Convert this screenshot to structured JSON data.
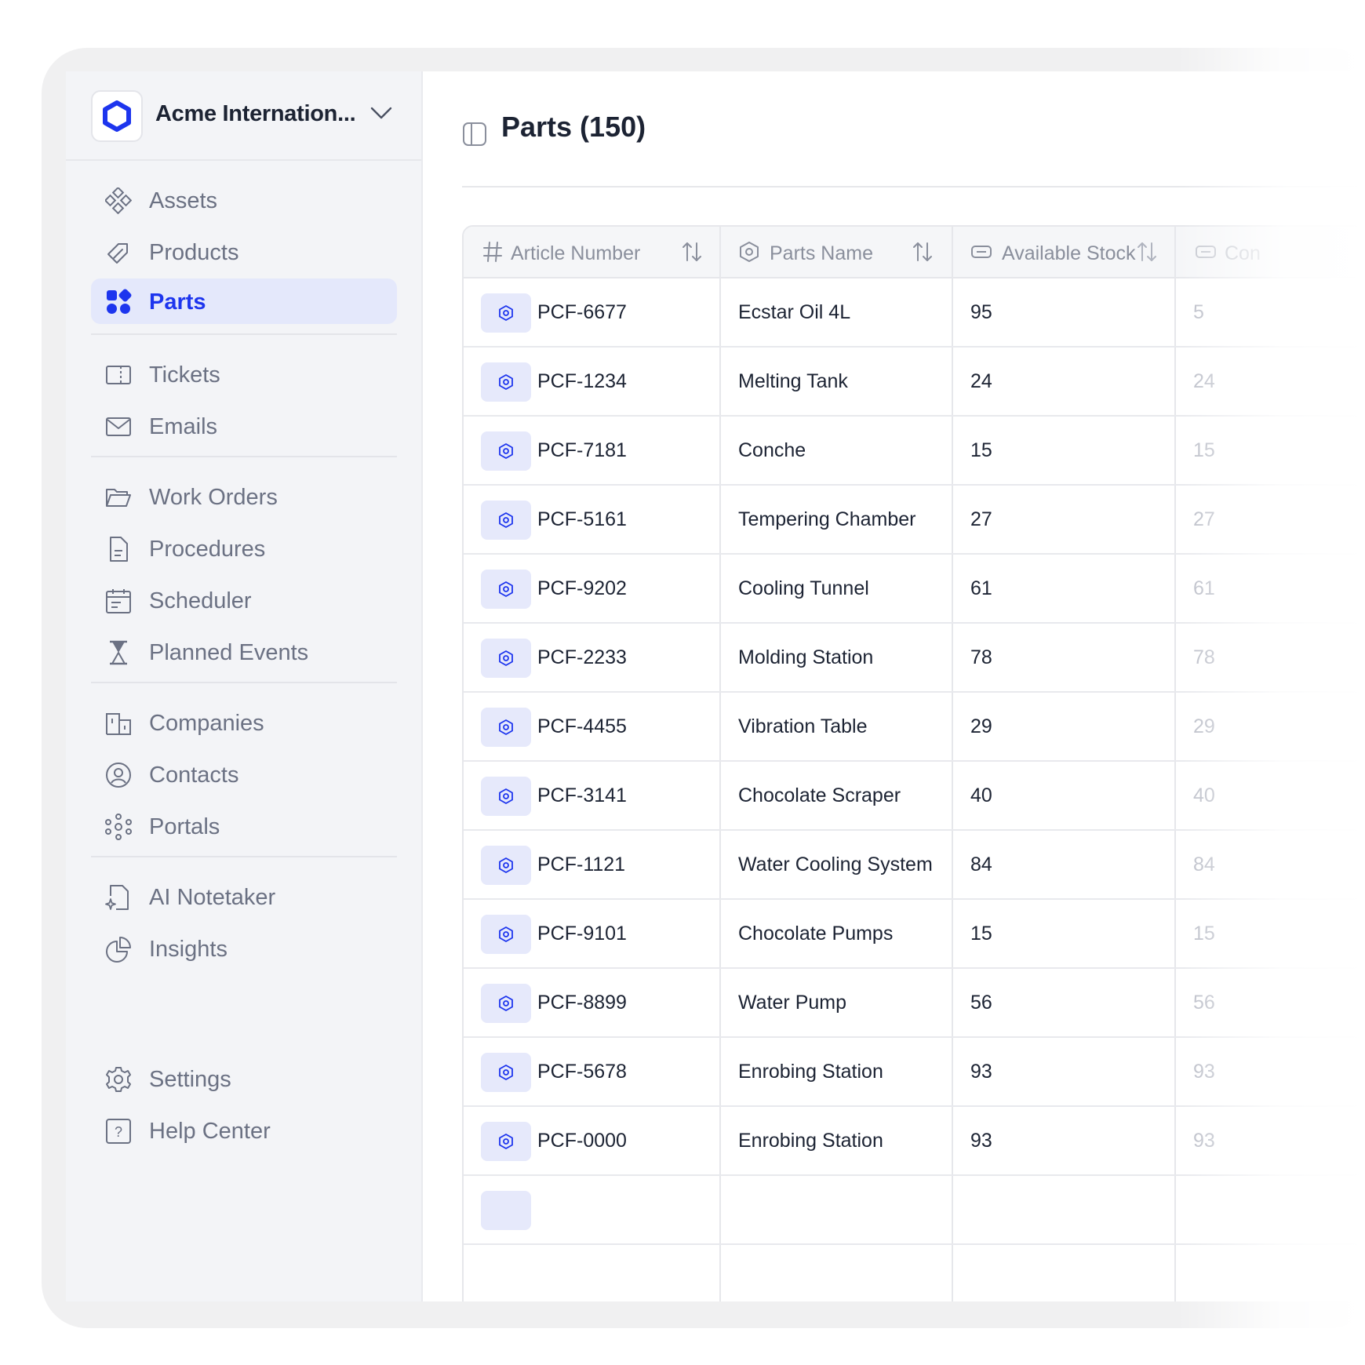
{
  "org": {
    "name": "Acme Internation..."
  },
  "nav": {
    "assets": "Assets",
    "products": "Products",
    "parts": "Parts",
    "tickets": "Tickets",
    "emails": "Emails",
    "work_orders": "Work Orders",
    "procedures": "Procedures",
    "scheduler": "Scheduler",
    "planned_events": "Planned Events",
    "companies": "Companies",
    "contacts": "Contacts",
    "portals": "Portals",
    "ai_notetaker": "AI Notetaker",
    "insights": "Insights",
    "settings": "Settings",
    "help_center": "Help Center"
  },
  "page": {
    "title": "Parts (150)"
  },
  "table": {
    "columns": [
      "Article Number",
      "Parts Name",
      "Available Stock",
      "Con"
    ],
    "rows": [
      [
        "PCF-6677",
        "Ecstar Oil 4L",
        "95",
        "5"
      ],
      [
        "PCF-1234",
        "Melting Tank",
        "24",
        "24"
      ],
      [
        "PCF-7181",
        "Conche",
        "15",
        "15"
      ],
      [
        "PCF-5161",
        "Tempering Chamber",
        "27",
        "27"
      ],
      [
        "PCF-9202",
        "Cooling Tunnel",
        "61",
        "61"
      ],
      [
        "PCF-2233",
        "Molding Station",
        "78",
        "78"
      ],
      [
        "PCF-4455",
        "Vibration Table",
        "29",
        "29"
      ],
      [
        "PCF-3141",
        "Chocolate Scraper",
        "40",
        "40"
      ],
      [
        "PCF-1121",
        "Water Cooling System",
        "84",
        "84"
      ],
      [
        "PCF-9101",
        "Chocolate Pumps",
        "15",
        "15"
      ],
      [
        "PCF-8899",
        "Water Pump",
        "56",
        "56"
      ],
      [
        "PCF-5678",
        "Enrobing Station",
        "93",
        "93"
      ],
      [
        "PCF-0000",
        "Enrobing Station",
        "93",
        "93"
      ]
    ]
  },
  "colors": {
    "accent": "#1d35ee",
    "accent_bg": "#e4e8fb",
    "text": "#1c2333",
    "muted": "#6b7183"
  }
}
